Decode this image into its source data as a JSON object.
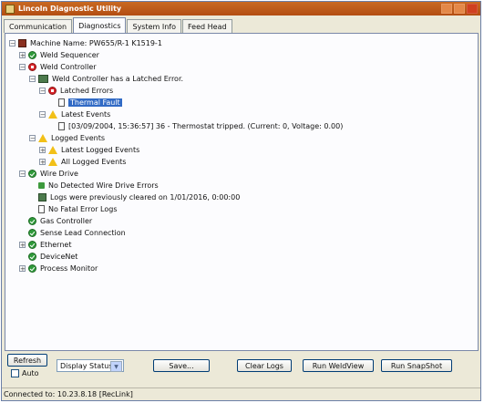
{
  "window": {
    "title": "Lincoln Diagnostic Utility"
  },
  "tabs": [
    {
      "label": "Communication"
    },
    {
      "label": "Diagnostics"
    },
    {
      "label": "System Info"
    },
    {
      "label": "Feed Head"
    }
  ],
  "tree": {
    "machine": "Machine Name: PW655/R-1 K1519-1",
    "weld_sequencer": "Weld Sequencer",
    "weld_controller": "Weld Controller",
    "latched_error_msg": "Weld Controller has a Latched Error.",
    "latched_errors": "Latched Errors",
    "thermal_fault": "Thermal Fault",
    "latest_events": "Latest Events",
    "event_detail": "[03/09/2004, 15:36:57] 36 - Thermostat tripped. (Current: 0, Voltage: 0.00)",
    "logged_events": "Logged Events",
    "latest_logged_events": "Latest Logged Events",
    "all_logged_events": "All Logged Events",
    "wire_drive": "Wire Drive",
    "no_wire_drive_errors": "No Detected Wire Drive Errors",
    "logs_cleared": "Logs were previously cleared on 1/01/2016, 0:00:00",
    "no_fatal_error_logs": "No Fatal Error Logs",
    "gas_controller": "Gas Controller",
    "sense_lead": "Sense Lead Connection",
    "ethernet": "Ethernet",
    "devicenet": "DeviceNet",
    "process_monitor": "Process Monitor"
  },
  "buttons": {
    "refresh": "Refresh",
    "auto": "Auto",
    "display_status": "Display Status",
    "save": "Save...",
    "clear_logs": "Clear Logs",
    "run_weldview": "Run WeldView",
    "run_snapshot": "Run SnapShot"
  },
  "status": "Connected to: 10.23.8.18 [RecLink]"
}
